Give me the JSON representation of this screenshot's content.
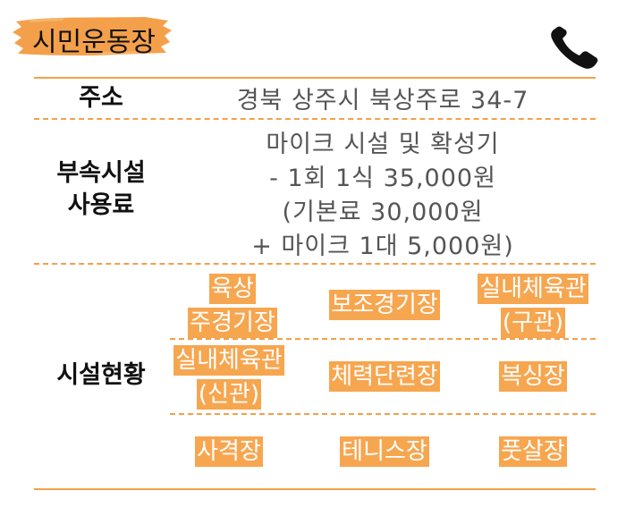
{
  "header": {
    "title": "시민운동장",
    "brush_color": "#f4a04a"
  },
  "icons": {
    "phone": "phone-icon"
  },
  "rows": {
    "address": {
      "label": "주소",
      "value": "경북 상주시 북상주로 34-7"
    },
    "fee": {
      "label_line1": "부속시설",
      "label_line2": "사용료",
      "lines": [
        "마이크 시설 및 확성기",
        "- 1회 1식 35,000원",
        "(기본료 30,000원",
        "+ 마이크 1대 5,000원)"
      ]
    },
    "facilities": {
      "label": "시설현황",
      "items": [
        [
          "육상",
          "주경기장"
        ],
        [
          "보조경기장"
        ],
        [
          "실내체육관",
          "(구관)"
        ],
        [
          "실내체육관",
          "(신관)"
        ],
        [
          "체력단련장"
        ],
        [
          "복싱장"
        ],
        [
          "사격장"
        ],
        [
          "테니스장"
        ],
        [
          "풋살장"
        ]
      ]
    }
  },
  "colors": {
    "accent": "#f4a04a",
    "highlight": "#f7a650",
    "highlight_text": "#ffffff",
    "value_text": "#555555",
    "label_text": "#111111"
  }
}
